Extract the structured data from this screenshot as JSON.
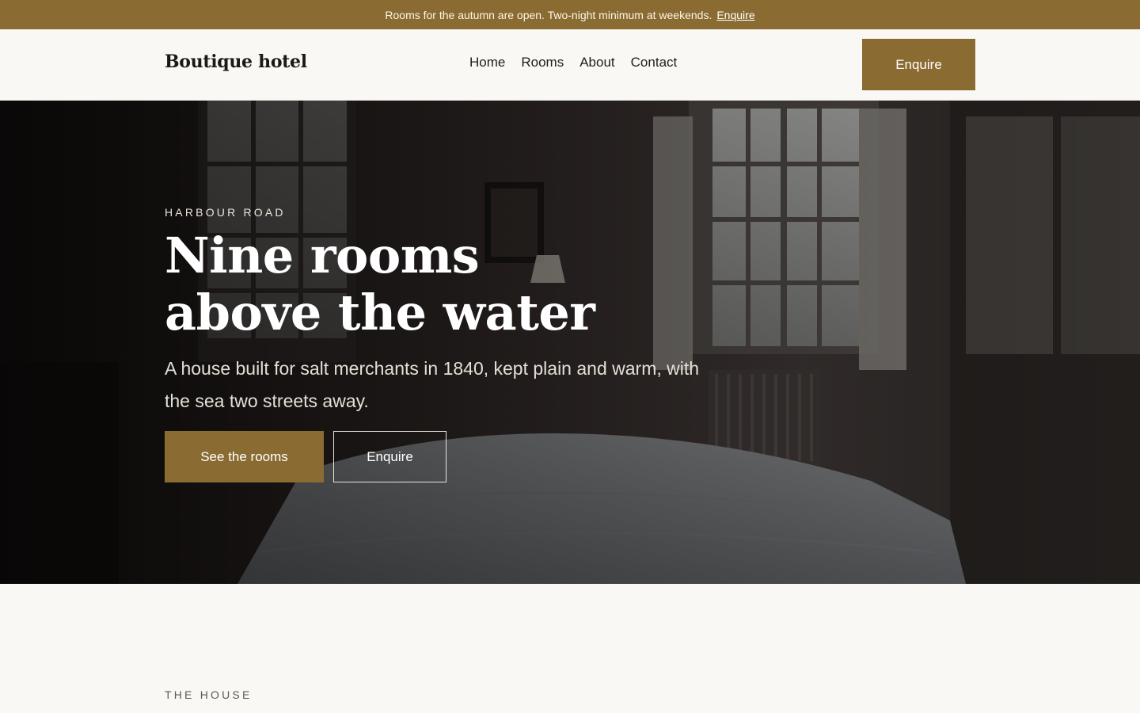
{
  "announcement": {
    "message": "Rooms for the autumn are open. Two-night minimum at weekends.",
    "link_label": "Enquire"
  },
  "header": {
    "brand": "Boutique hotel",
    "nav": [
      {
        "label": "Home"
      },
      {
        "label": "Rooms"
      },
      {
        "label": "About"
      },
      {
        "label": "Contact"
      }
    ],
    "cta_label": "Enquire"
  },
  "hero": {
    "eyebrow": "HARBOUR ROAD",
    "title_line1": "Nine rooms",
    "title_line2": "above the water",
    "subtitle": "A house built for salt merchants in 1840, kept plain and warm, with the sea two streets away.",
    "primary_button": "See the rooms",
    "secondary_button": "Enquire"
  },
  "house_section": {
    "eyebrow": "THE HOUSE"
  },
  "colors": {
    "accent": "#8a6c33",
    "background": "#f9f8f4",
    "text": "#1e1b16"
  }
}
